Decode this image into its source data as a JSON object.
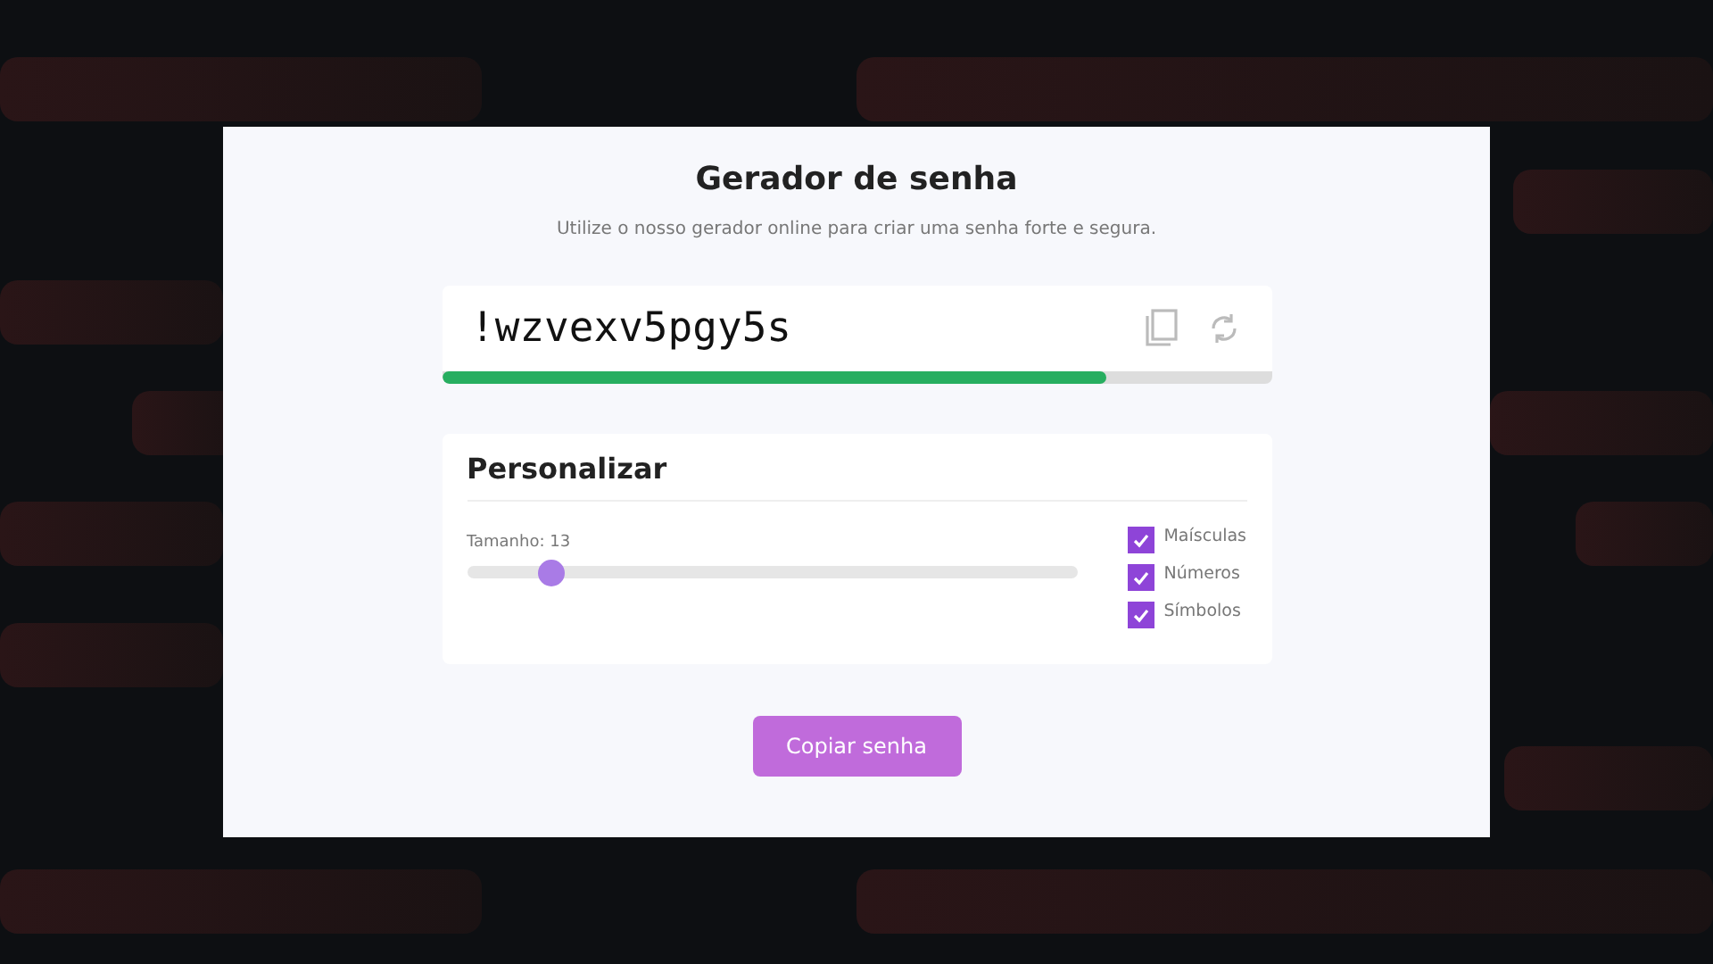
{
  "title": "Gerador de senha",
  "subtitle": "Utilize o nosso gerador online para criar uma senha forte e segura.",
  "password": {
    "value": "!wzvexv5pgy5s",
    "strength": {
      "level": 0.8
    }
  },
  "options": {
    "title": "Personalizar",
    "length": {
      "label": "Tamanho: 13",
      "level": 0.14
    },
    "checkboxes": [
      {
        "label": "Maísculas",
        "checked": true
      },
      {
        "label": "Números",
        "checked": true
      },
      {
        "label": "Símbolos",
        "checked": true
      }
    ]
  },
  "button": "Copiar senha"
}
